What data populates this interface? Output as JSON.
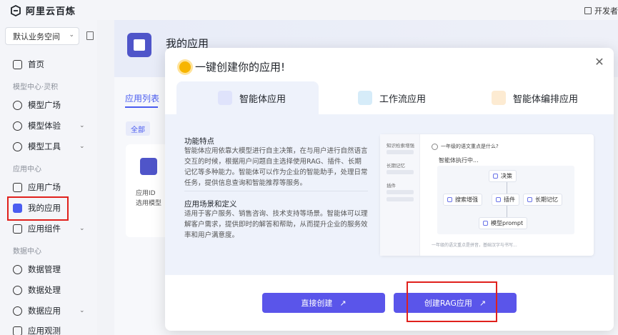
{
  "topbar": {
    "brand": "阿里云百炼",
    "right_text": "开发者"
  },
  "sidebar": {
    "workspace": "默认业务空间",
    "items": [
      {
        "label": "首页",
        "top": 0
      },
      {
        "label": "模型广场"
      },
      {
        "label": "模型体验"
      },
      {
        "label": "模型工具"
      },
      {
        "label": "应用广场"
      },
      {
        "label": "我的应用"
      },
      {
        "label": "应用组件"
      },
      {
        "label": "数据管理"
      },
      {
        "label": "数据处理"
      },
      {
        "label": "数据应用"
      },
      {
        "label": "应用观测"
      }
    ],
    "sections": {
      "model": "模型中心·灵积",
      "app": "应用中心",
      "data": "数据中心"
    }
  },
  "main": {
    "title": "我的应用",
    "tab": "应用列表",
    "filter_all": "全部",
    "card_line1": "应用ID",
    "card_line2": "选用模型"
  },
  "modal": {
    "title": "一键创建你的应用!",
    "tabs": [
      "智能体应用",
      "工作流应用",
      "智能体编排应用"
    ],
    "feature_heading": "功能特点",
    "feature_text": "智能体应用依靠大模型进行自主决策，在与用户进行自然语言交互的时候，根据用户问题自主选择使用RAG、插件、长期记忆等多种能力。智能体可以作为企业的智能助手，处理日常任务，提供信息查询和智能推荐等服务。",
    "scene_heading": "应用场景和定义",
    "scene_text": "适用于客户服务、销售咨询、技术支持等场景。智能体可以理解客户需求，提供即时的解答和帮助，从而提升企业的服务效率和用户满意度。",
    "preview": {
      "side_labels": [
        "知识检索增强",
        "长期记忆",
        "插件"
      ],
      "question": "一年级的语文重点是什么?",
      "executing": "智能体执行中...",
      "node_decision": "决策",
      "node_search": "搜索增强",
      "node_plugin": "插件",
      "node_memory": "长期记忆",
      "node_prompt": "模型prompt",
      "input_hint": "一年级的语文重点是拼音，基础汉字与书写..."
    },
    "buttons": {
      "direct": "直接创建",
      "rag": "创建RAG应用"
    }
  },
  "colors": {
    "accent": "#5a55ea",
    "highlight": "#e0201c"
  }
}
